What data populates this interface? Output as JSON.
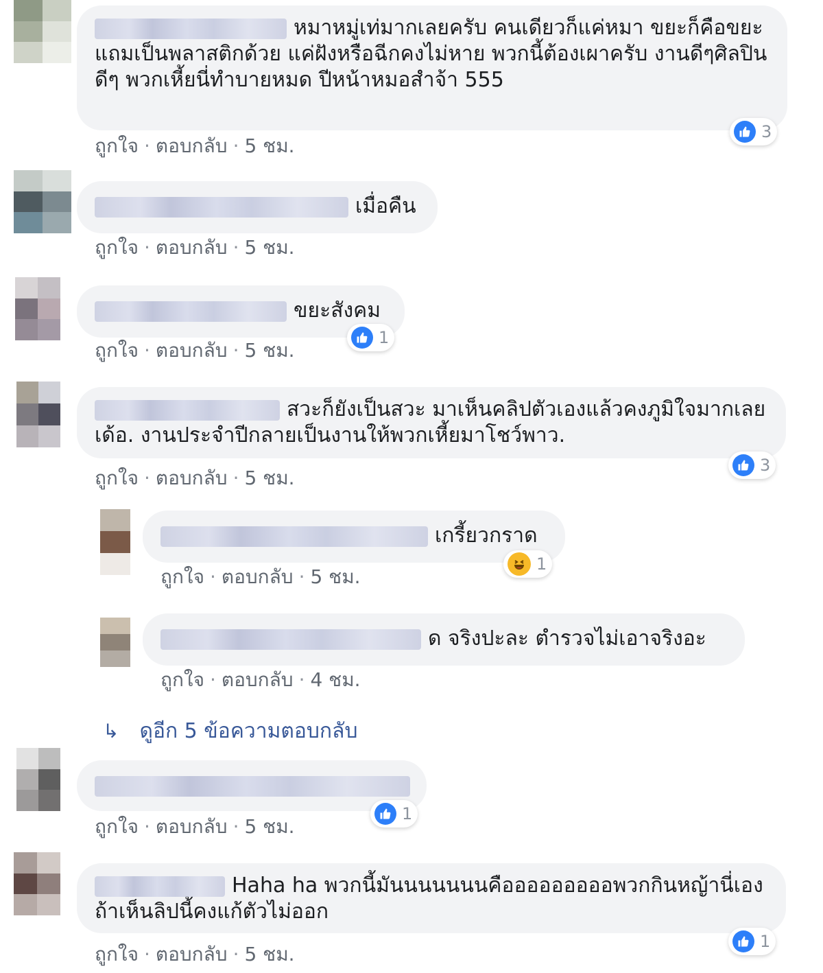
{
  "labels": {
    "like": "ถูกใจ",
    "reply": "ตอบกลับ",
    "sep": "·"
  },
  "colors": {
    "like_blue": "#2d7ff9",
    "haha_yellow": "#f7b928",
    "bubble": "#f2f3f5",
    "link": "#385898"
  },
  "comments": [
    {
      "text": "หมาหมู่เท่มากเลยครับ คนเดียวก็แค่หมา ขยะก็คือขยะ แถมเป็นพลาสติกด้วย แค่ฝังหรือฉีกคงไม่หาย พวกนี้ต้องเผาครับ งานดีๆศิลปินดีๆ พวกเหี้ยนี่ทำบายหมด ปีหน้าหมอสำจ้า 555",
      "time": "5 ชม.",
      "reaction_count": "3",
      "reaction_icon": "like-icon"
    },
    {
      "text": "เมื่อคืน",
      "time": "5 ชม."
    },
    {
      "text": "ขยะสังคม",
      "time": "5 ชม.",
      "reaction_count": "1",
      "reaction_icon": "like-icon"
    },
    {
      "text": "สวะก็ยังเป็นสวะ มาเห็นคลิปตัวเองแล้วคงภูมิใจมากเลยเด้อ. งานประจำปีกลายเป็นงานให้พวกเหี้ยมาโชว์พาว.",
      "time": "5 ชม.",
      "reaction_count": "3",
      "reaction_icon": "like-icon"
    },
    {
      "text": "เกรี้ยวกราด",
      "time": "5 ชม.",
      "reaction_count": "1",
      "reaction_icon": "haha-icon"
    },
    {
      "text": "ด จริงปะละ ตำรวจไม่เอาจริงอะ",
      "time": "4 ชม."
    },
    {
      "text": "",
      "time": "5 ชม.",
      "reaction_count": "1",
      "reaction_icon": "like-icon"
    },
    {
      "text": "Haha ha พวกนี้มันนนนนนนคือออออออออพวกกินหญ้านี่เองถ้าเห็นลิปนี้คงแก้ตัวไม่ออก",
      "time": "5 ชม.",
      "reaction_count": "1",
      "reaction_icon": "like-icon"
    }
  ],
  "view_more_replies": "ดูอีก 5 ข้อความตอบกลับ"
}
